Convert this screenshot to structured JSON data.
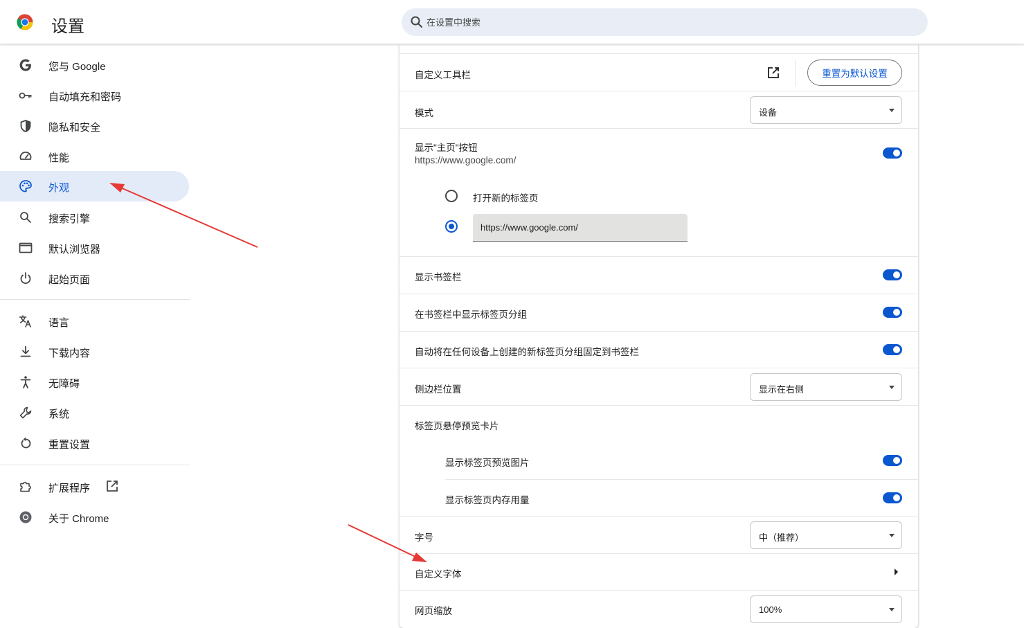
{
  "header": {
    "title": "设置",
    "search_placeholder": "在设置中搜索",
    "logo_icon": "chrome-logo-icon",
    "search_icon": "search-icon"
  },
  "sidebar": {
    "items": [
      {
        "label": "您与 Google",
        "icon": "google-g-icon"
      },
      {
        "label": "自动填充和密码",
        "icon": "key-icon"
      },
      {
        "label": "隐私和安全",
        "icon": "shield-icon"
      },
      {
        "label": "性能",
        "icon": "speedometer-icon"
      },
      {
        "label": "外观",
        "icon": "palette-icon",
        "active": true
      },
      {
        "label": "搜索引擎",
        "icon": "search-icon"
      },
      {
        "label": "默认浏览器",
        "icon": "browser-window-icon"
      },
      {
        "label": "起始页面",
        "icon": "power-icon"
      },
      {
        "label": "语言",
        "icon": "translate-icon"
      },
      {
        "label": "下载内容",
        "icon": "download-icon"
      },
      {
        "label": "无障碍",
        "icon": "accessibility-icon"
      },
      {
        "label": "系统",
        "icon": "wrench-icon"
      },
      {
        "label": "重置设置",
        "icon": "reset-icon"
      },
      {
        "label": "扩展程序",
        "icon": "puzzle-icon"
      },
      {
        "label": "关于 Chrome",
        "icon": "chrome-outline-icon"
      }
    ]
  },
  "appearance": {
    "toolbar": {
      "label": "自定义工具栏",
      "reset_label": "重置为默认设置"
    },
    "mode": {
      "label": "模式",
      "value": "设备"
    },
    "home_button": {
      "label": "显示\"主页\"按钮",
      "url": "https://www.google.com/",
      "enabled": true,
      "option_new_tab": "打开新的标签页",
      "custom_url_value": "https://www.google.com/"
    },
    "bookmarks_bar": {
      "label": "显示书签栏",
      "enabled": true
    },
    "tab_groups_bar": {
      "label": "在书签栏中显示标签页分组",
      "enabled": true
    },
    "auto_pin_groups": {
      "label": "自动将在任何设备上创建的新标签页分组固定到书签栏",
      "enabled": true
    },
    "side_panel": {
      "label": "侧边栏位置",
      "value": "显示在右侧"
    },
    "hover_card": {
      "label": "标签页悬停预览卡片",
      "preview_image": {
        "label": "显示标签页预览图片",
        "enabled": true
      },
      "memory_usage": {
        "label": "显示标签页内存用量",
        "enabled": true
      }
    },
    "font_size": {
      "label": "字号",
      "value": "中（推荐）"
    },
    "custom_fonts": {
      "label": "自定义字体"
    },
    "page_zoom": {
      "label": "网页缩放",
      "value": "100%"
    }
  },
  "colors": {
    "accent": "#0b57d0",
    "active_bg": "#e3ebf9",
    "search_bg": "#e9eef6",
    "annotation": "#e53935"
  }
}
